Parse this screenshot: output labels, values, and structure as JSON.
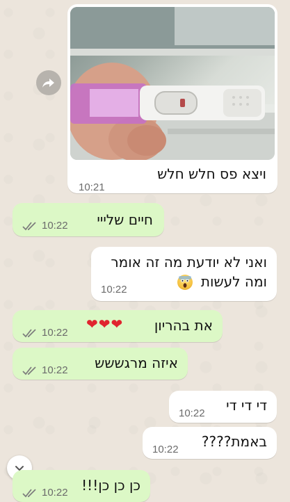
{
  "messages": [
    {
      "id": "m1",
      "direction": "incoming",
      "has_image": true,
      "text": "ויצא פס חלש חלש",
      "time": "10:21"
    },
    {
      "id": "m2",
      "direction": "outgoing",
      "text": "חיים שלייי",
      "time": "10:22",
      "status": "read"
    },
    {
      "id": "m3",
      "direction": "incoming",
      "line1": "ואני לא יודעת מה זה אומר",
      "line2": "ומה לעשות",
      "emoji": "face-screaming-in-fear",
      "time": "10:22"
    },
    {
      "id": "m4",
      "direction": "outgoing",
      "text": "את בהריון",
      "hearts": "❤❤❤",
      "time": "10:22",
      "status": "read"
    },
    {
      "id": "m5",
      "direction": "outgoing",
      "text": "איזה מרגששש",
      "time": "10:22",
      "status": "read"
    },
    {
      "id": "m6",
      "direction": "incoming",
      "text": "די די די",
      "time": "10:22"
    },
    {
      "id": "m7",
      "direction": "incoming",
      "text": "באמת????",
      "time": "10:22"
    },
    {
      "id": "m8",
      "direction": "outgoing",
      "text": "כן כן כן!!!",
      "time": "10:22",
      "status": "read"
    }
  ],
  "colors": {
    "background": "#ece5dc",
    "incoming": "#ffffff",
    "outgoing": "#dcf8c6",
    "read_ticks": "#7d7d7d",
    "heart": "#e0242e"
  },
  "icons": {
    "forward": "forward-icon",
    "scroll_down": "chevron-down-icon",
    "read_receipt": "double-check-icon"
  }
}
